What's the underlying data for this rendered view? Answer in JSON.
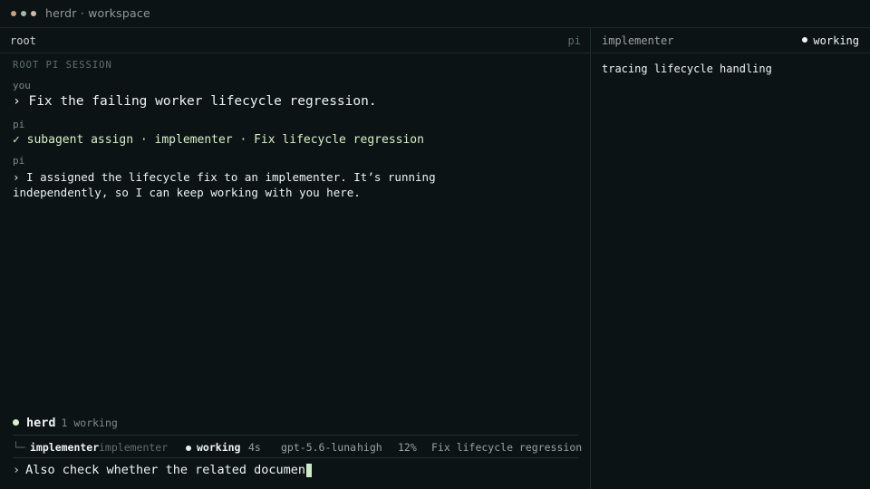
{
  "window": {
    "title": "herdr · workspace",
    "dot_colors": [
      "#c9a07a",
      "#a7b4b4",
      "#c9c0a0"
    ]
  },
  "left_pane": {
    "title": "root",
    "tag": "pi",
    "section_label": "ROOT PI SESSION",
    "messages": [
      {
        "speaker": "you",
        "text": "› Fix the failing worker lifecycle regression."
      },
      {
        "speaker": "pi",
        "text": "✓ subagent assign · implementer · Fix lifecycle regression"
      },
      {
        "speaker": "pi",
        "text": "› I assigned the lifecycle fix to an implementer. It’s running independently, so I can keep working with you here."
      }
    ],
    "herd": {
      "name": "herd",
      "count": "1 working",
      "agent": {
        "tree": "└─",
        "name": "implementer",
        "role": "implementer",
        "status": "working",
        "elapsed": "4s",
        "model": "gpt-5.6-luna",
        "effort": "high",
        "progress": "12%",
        "task": "Fix lifecycle regression"
      }
    },
    "input": {
      "prompt": "›",
      "value": "Also check whether the related documen"
    }
  },
  "right_pane": {
    "title": "implementer",
    "status": "working",
    "body": "tracing lifecycle handling"
  },
  "colors": {
    "background": "#0c1315",
    "accent_green": "#d8efce"
  }
}
